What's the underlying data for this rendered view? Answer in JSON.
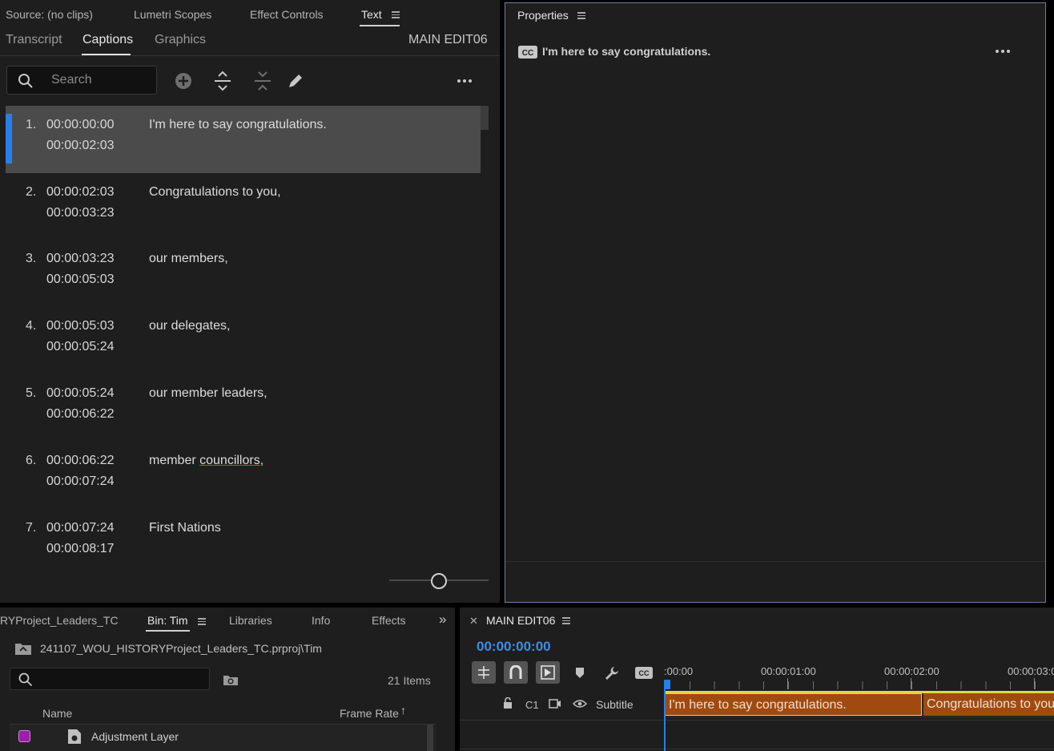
{
  "text_panel": {
    "tabs": [
      {
        "label": "Source: (no clips)"
      },
      {
        "label": "Lumetri Scopes"
      },
      {
        "label": "Effect Controls"
      },
      {
        "label": "Text"
      }
    ],
    "subtabs": [
      {
        "label": "Transcript"
      },
      {
        "label": "Captions"
      },
      {
        "label": "Graphics"
      }
    ],
    "sequence_name": "MAIN EDIT06",
    "search_placeholder": "Search",
    "captions": [
      {
        "num": "1.",
        "start": "00:00:00:00",
        "end": "00:00:02:03",
        "text": "I'm here to say congratulations."
      },
      {
        "num": "2.",
        "start": "00:00:02:03",
        "end": "00:00:03:23",
        "text": "Congratulations to you,"
      },
      {
        "num": "3.",
        "start": "00:00:03:23",
        "end": "00:00:05:03",
        "text": "our members,"
      },
      {
        "num": "4.",
        "start": "00:00:05:03",
        "end": "00:00:05:24",
        "text": "our delegates,"
      },
      {
        "num": "5.",
        "start": "00:00:05:24",
        "end": "00:00:06:22",
        "text": "our member leaders,"
      },
      {
        "num": "6.",
        "start": "00:00:06:22",
        "end": "00:00:07:24",
        "text_prefix": "member ",
        "text_underlined": "councillors",
        "text_suffix": ","
      },
      {
        "num": "7.",
        "start": "00:00:07:24",
        "end": "00:00:08:17",
        "text": "First Nations"
      }
    ]
  },
  "properties_panel": {
    "title": "Properties",
    "caption_text": "I'm here to say congratulations."
  },
  "project_panel": {
    "tabs": [
      {
        "label": "RYProject_Leaders_TC"
      },
      {
        "label": "Bin: Tim"
      },
      {
        "label": "Libraries"
      },
      {
        "label": "Info"
      },
      {
        "label": "Effects"
      }
    ],
    "path": "241107_WOU_HISTORYProject_Leaders_TC.prproj\\Tim",
    "item_count": "21 Items",
    "columns": {
      "name": "Name",
      "frame_rate": "Frame Rate"
    },
    "items": [
      {
        "name": "Adjustment Layer",
        "color": "#9b1fa8"
      }
    ]
  },
  "timeline_panel": {
    "sequence_name": "MAIN EDIT06",
    "timecode": "00:00:00:00",
    "ruler": [
      ":00:00",
      "00:00:01:00",
      "00:00:02:00",
      "00:00:03:0"
    ],
    "track": {
      "id": "C1",
      "name": "Subtitle"
    },
    "clips": [
      {
        "text": "I'm here to say congratulations."
      },
      {
        "text": "Congratulations to you"
      }
    ]
  },
  "colors": {
    "accent_blue": "#2680eb",
    "clip_orange": "#a14a0f",
    "panel_bg": "#1e1e1e"
  }
}
